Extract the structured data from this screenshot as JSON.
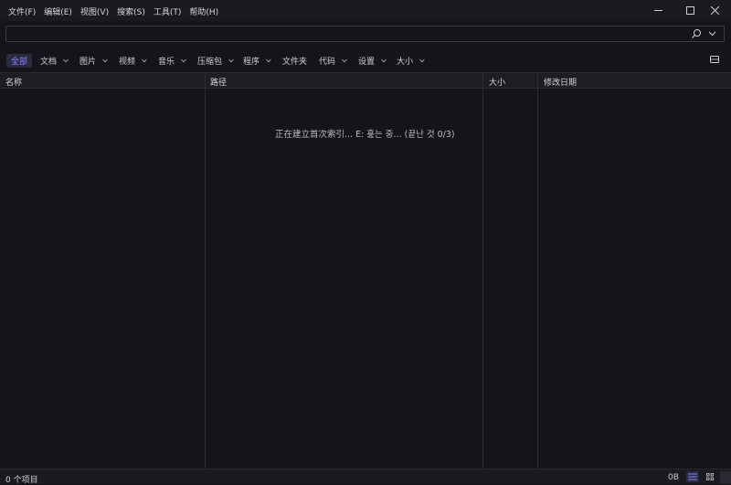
{
  "menu": [
    "文件(F)",
    "编辑(E)",
    "视图(V)",
    "搜索(S)",
    "工具(T)",
    "帮助(H)"
  ],
  "search": {
    "value": "",
    "placeholder": ""
  },
  "filters": [
    {
      "label": "全部",
      "dropdown": false,
      "active": true
    },
    {
      "label": "文档",
      "dropdown": true
    },
    {
      "label": "图片",
      "dropdown": true
    },
    {
      "label": "视频",
      "dropdown": true
    },
    {
      "label": "音乐",
      "dropdown": true
    },
    {
      "label": "压缩包",
      "dropdown": true
    },
    {
      "label": "程序",
      "dropdown": true
    },
    {
      "label": "文件夹",
      "dropdown": false
    },
    {
      "label": "代码",
      "dropdown": true
    },
    {
      "label": "设置",
      "dropdown": true
    },
    {
      "label": "大小",
      "dropdown": true
    }
  ],
  "columns": {
    "name": "名称",
    "path": "路径",
    "size": "大小",
    "modified": "修改日期"
  },
  "indexing_message": "正在建立首次索引... E: 훑는 중... (끝난 것 0/3)",
  "status": {
    "count": "0 个项目",
    "total_size": "0B"
  },
  "colors": {
    "background": "#15141b",
    "accent": "#8a86ff",
    "active_bg": "#2a2a40"
  }
}
